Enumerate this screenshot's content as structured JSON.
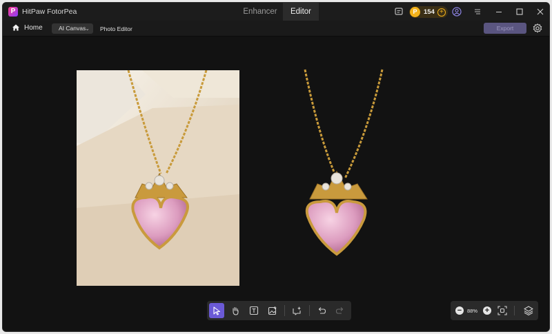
{
  "app": {
    "title": "HitPaw FotorPea",
    "logo_letter": "P"
  },
  "tabs": [
    {
      "label": "Enhancer",
      "active": false
    },
    {
      "label": "Editor",
      "active": true
    }
  ],
  "titlebar": {
    "coins": "154",
    "icons": [
      "feedback-icon",
      "coin-icon",
      "add-coins-icon",
      "account-icon",
      "menu-icon",
      "minimize-icon",
      "maximize-icon",
      "close-icon"
    ]
  },
  "subbar": {
    "home_label": "Home",
    "mode_dropdown": "AI Canvas",
    "breadcrumb": "Photo Editor",
    "export_label": "Export"
  },
  "zoom": {
    "level": "88%"
  },
  "colors": {
    "accent": "#6b5ad6",
    "background": "#121212",
    "coin": "#f3b21b"
  }
}
